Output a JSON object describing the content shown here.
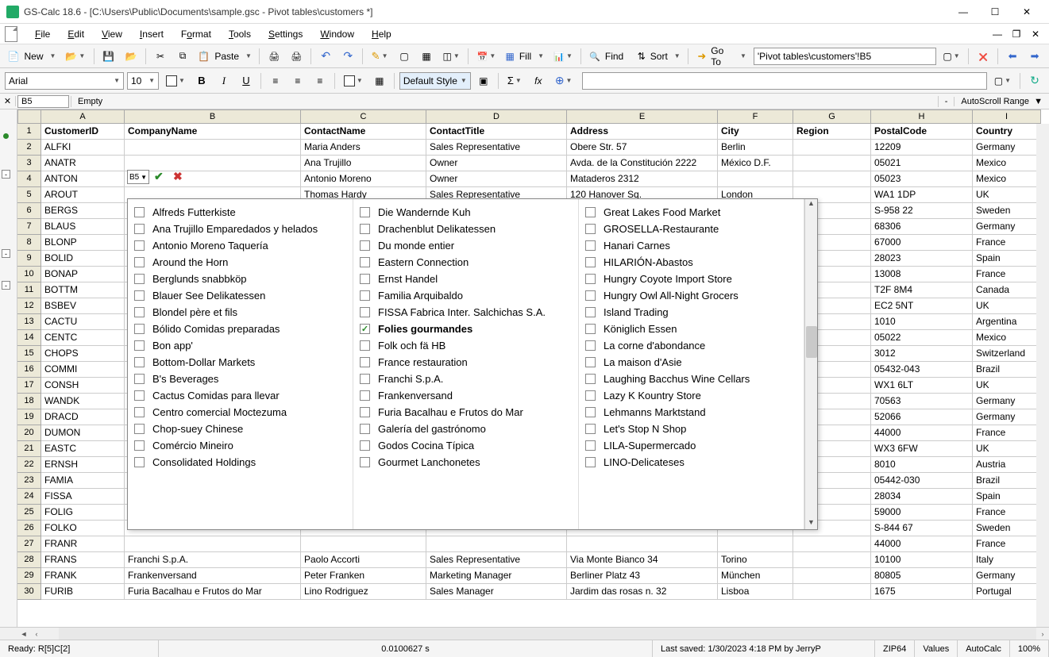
{
  "title": "GS-Calc 18.6 - [C:\\Users\\Public\\Documents\\sample.gsc - Pivot tables\\customers *]",
  "menu": {
    "file": "File",
    "edit": "Edit",
    "view": "View",
    "insert": "Insert",
    "format": "Format",
    "tools": "Tools",
    "settings": "Settings",
    "window": "Window",
    "help": "Help"
  },
  "toolbar": {
    "new": "New",
    "paste": "Paste",
    "fill": "Fill",
    "find": "Find",
    "sort": "Sort",
    "goto": "Go To",
    "address": "'Pivot tables\\customers'!B5"
  },
  "format": {
    "font": "Arial",
    "size": "10",
    "defaultStyle": "Default Style"
  },
  "ref": {
    "cell": "B5",
    "type": "Empty",
    "dash": "-",
    "autoscroll": "AutoScroll Range"
  },
  "cols": {
    "A": "A",
    "B": "B",
    "C": "C",
    "D": "D",
    "E": "E",
    "F": "F",
    "G": "G",
    "H": "H",
    "I": "I",
    "widths": {
      "A": 105,
      "B": 222,
      "C": 158,
      "D": 177,
      "E": 190,
      "F": 95,
      "G": 98,
      "H": 128,
      "I": 86
    }
  },
  "headers": {
    "A": "CustomerID",
    "B": "CompanyName",
    "C": "ContactName",
    "D": "ContactTitle",
    "E": "Address",
    "F": "City",
    "G": "Region",
    "H": "PostalCode",
    "I": "Country"
  },
  "rows": [
    {
      "n": 2,
      "A": "ALFKI",
      "C": "Maria Anders",
      "D": "Sales Representative",
      "E": "Obere Str. 57",
      "F": "Berlin",
      "H": "12209",
      "I": "Germany"
    },
    {
      "n": 3,
      "A": "ANATR",
      "C": "Ana Trujillo",
      "D": "Owner",
      "E": "Avda. de la Constitución 2222",
      "F": "México D.F.",
      "H": "05021",
      "I": "Mexico"
    },
    {
      "n": 4,
      "A": "ANTON",
      "C": "Antonio Moreno",
      "D": "Owner",
      "E": "Mataderos 2312",
      "H": "05023",
      "I": "Mexico"
    },
    {
      "n": 5,
      "A": "AROUT",
      "C": "Thomas Hardy",
      "D": "Sales Representative",
      "E": "120 Hanover Sq.",
      "F": "London",
      "H": "WA1 1DP",
      "I": "UK"
    },
    {
      "n": 6,
      "A": "BERGS",
      "H": "S-958 22",
      "I": "Sweden"
    },
    {
      "n": 7,
      "A": "BLAUS",
      "H": "68306",
      "I": "Germany"
    },
    {
      "n": 8,
      "A": "BLONP",
      "H": "67000",
      "I": "France"
    },
    {
      "n": 9,
      "A": "BOLID",
      "H": "28023",
      "I": "Spain"
    },
    {
      "n": 10,
      "A": "BONAP",
      "H": "13008",
      "I": "France"
    },
    {
      "n": 11,
      "A": "BOTTM",
      "H": "T2F 8M4",
      "I": "Canada"
    },
    {
      "n": 12,
      "A": "BSBEV",
      "H": "EC2 5NT",
      "I": "UK"
    },
    {
      "n": 13,
      "A": "CACTU",
      "H": "1010",
      "I": "Argentina"
    },
    {
      "n": 14,
      "A": "CENTC",
      "H": "05022",
      "I": "Mexico"
    },
    {
      "n": 15,
      "A": "CHOPS",
      "H": "3012",
      "I": "Switzerland"
    },
    {
      "n": 16,
      "A": "COMMI",
      "H": "05432-043",
      "I": "Brazil"
    },
    {
      "n": 17,
      "A": "CONSH",
      "H": "WX1 6LT",
      "I": "UK"
    },
    {
      "n": 18,
      "A": "WANDK",
      "H": "70563",
      "I": "Germany"
    },
    {
      "n": 19,
      "A": "DRACD",
      "H": "52066",
      "I": "Germany"
    },
    {
      "n": 20,
      "A": "DUMON",
      "H": "44000",
      "I": "France"
    },
    {
      "n": 21,
      "A": "EASTC",
      "H": "WX3 6FW",
      "I": "UK"
    },
    {
      "n": 22,
      "A": "ERNSH",
      "H": "8010",
      "I": "Austria"
    },
    {
      "n": 23,
      "A": "FAMIA",
      "H": "05442-030",
      "I": "Brazil"
    },
    {
      "n": 24,
      "A": "FISSA",
      "H": "28034",
      "I": "Spain"
    },
    {
      "n": 25,
      "A": "FOLIG",
      "H": "59000",
      "I": "France"
    },
    {
      "n": 26,
      "A": "FOLKO",
      "H": "S-844 67",
      "I": "Sweden"
    },
    {
      "n": 27,
      "A": "FRANR",
      "H": "44000",
      "I": "France"
    },
    {
      "n": 28,
      "A": "FRANS",
      "B": "Franchi S.p.A.",
      "C": "Paolo Accorti",
      "D": "Sales Representative",
      "E": "Via Monte Bianco 34",
      "F": "Torino",
      "H": "10100",
      "I": "Italy"
    },
    {
      "n": 29,
      "A": "FRANK",
      "B": "Frankenversand",
      "C": "Peter Franken",
      "D": "Marketing Manager",
      "E": "Berliner Platz 43",
      "F": "München",
      "H": "80805",
      "I": "Germany"
    },
    {
      "n": 30,
      "A": "FURIB",
      "B": "Furia Bacalhau e Frutos do Mar",
      "C": "Lino Rodriguez",
      "D": "Sales Manager",
      "E": "Jardim das rosas n. 32",
      "F": "Lisboa",
      "H": "1675",
      "I": "Portugal"
    }
  ],
  "inplace": "B5",
  "dropdown": {
    "col1": [
      "Alfreds Futterkiste",
      "Ana Trujillo Emparedados y helados",
      "Antonio Moreno Taquería",
      "Around the Horn",
      "Berglunds snabbköp",
      "Blauer See Delikatessen",
      "Blondel père et fils",
      "Bólido Comidas preparadas",
      "Bon app'",
      "Bottom-Dollar Markets",
      "B's Beverages",
      "Cactus Comidas para llevar",
      "Centro comercial Moctezuma",
      "Chop-suey Chinese",
      "Comércio Mineiro",
      "Consolidated Holdings"
    ],
    "col2": [
      "Die Wandernde Kuh",
      "Drachenblut Delikatessen",
      "Du monde entier",
      "Eastern Connection",
      "Ernst Handel",
      "Familia Arquibaldo",
      "FISSA Fabrica Inter. Salchichas S.A.",
      "Folies gourmandes",
      "Folk och fä HB",
      "France restauration",
      "Franchi S.p.A.",
      "Frankenversand",
      "Furia Bacalhau e Frutos do Mar",
      "Galería del gastrónomo",
      "Godos Cocina Típica",
      "Gourmet Lanchonetes"
    ],
    "col3": [
      "Great Lakes Food Market",
      "GROSELLA-Restaurante",
      "Hanari Carnes",
      "HILARIÓN-Abastos",
      "Hungry Coyote Import Store",
      "Hungry Owl All-Night Grocers",
      "Island Trading",
      "Königlich Essen",
      "La corne d'abondance",
      "La maison d'Asie",
      "Laughing Bacchus Wine Cellars",
      "Lazy K Kountry Store",
      "Lehmanns Marktstand",
      "Let's Stop N Shop",
      "LILA-Supermercado",
      "LINO-Delicateses"
    ],
    "checked": "Folies gourmandes"
  },
  "status": {
    "ready": "Ready:  R[5]C[2]",
    "time": "0.0100627 s",
    "saved": "Last saved:  1/30/2023 4:18 PM  by  JerryP",
    "zip": "ZIP64",
    "values": "Values",
    "autocalc": "AutoCalc",
    "zoom": "100%"
  }
}
